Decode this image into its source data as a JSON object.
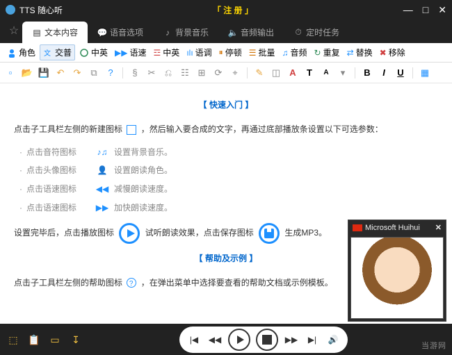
{
  "window": {
    "app_title": "TTS 随心听",
    "center_banner": "「 注 册 」"
  },
  "tabs": {
    "text_content": "文本内容",
    "voice_options": "语音选项",
    "bg_music": "背景音乐",
    "audio_output": "音频输出",
    "timer_task": "定时任务"
  },
  "toolbar": {
    "role": "角色",
    "jiaopu": "交普",
    "zhongying": "中英",
    "speed": "语速",
    "zhongying2": "中英",
    "tone": "语调",
    "pause": "停顿",
    "batch": "批量",
    "audio": "音频",
    "repeat": "重复",
    "replace": "替换",
    "remove": "移除"
  },
  "content": {
    "header1": "【 快速入门 】",
    "line1a": "点击子工具栏左侧的新建图标",
    "line1b": "，然后输入要合成的文字，再通过底部播放条设置以下可选参数：",
    "bullets": [
      {
        "left": "点击音符图标",
        "right": "设置背景音乐。"
      },
      {
        "left": "点击头像图标",
        "right": "设置朗读角色。"
      },
      {
        "left": "点击语速图标",
        "right": "减慢朗读速度。"
      },
      {
        "left": "点击语速图标",
        "right": "加快朗读速度。"
      }
    ],
    "line2a": "设置完毕后，点击播放图标",
    "line2b": "试听朗读效果，点击保存图标",
    "line2c": "生成MP3。",
    "header2": "【 帮助及示例 】",
    "line3a": "点击子工具栏左侧的帮助图标",
    "line3b": "，在弹出菜单中选择要查看的帮助文档或示例模板。"
  },
  "voice_popup": {
    "name": "Microsoft Huihui"
  },
  "watermark": "当游网"
}
